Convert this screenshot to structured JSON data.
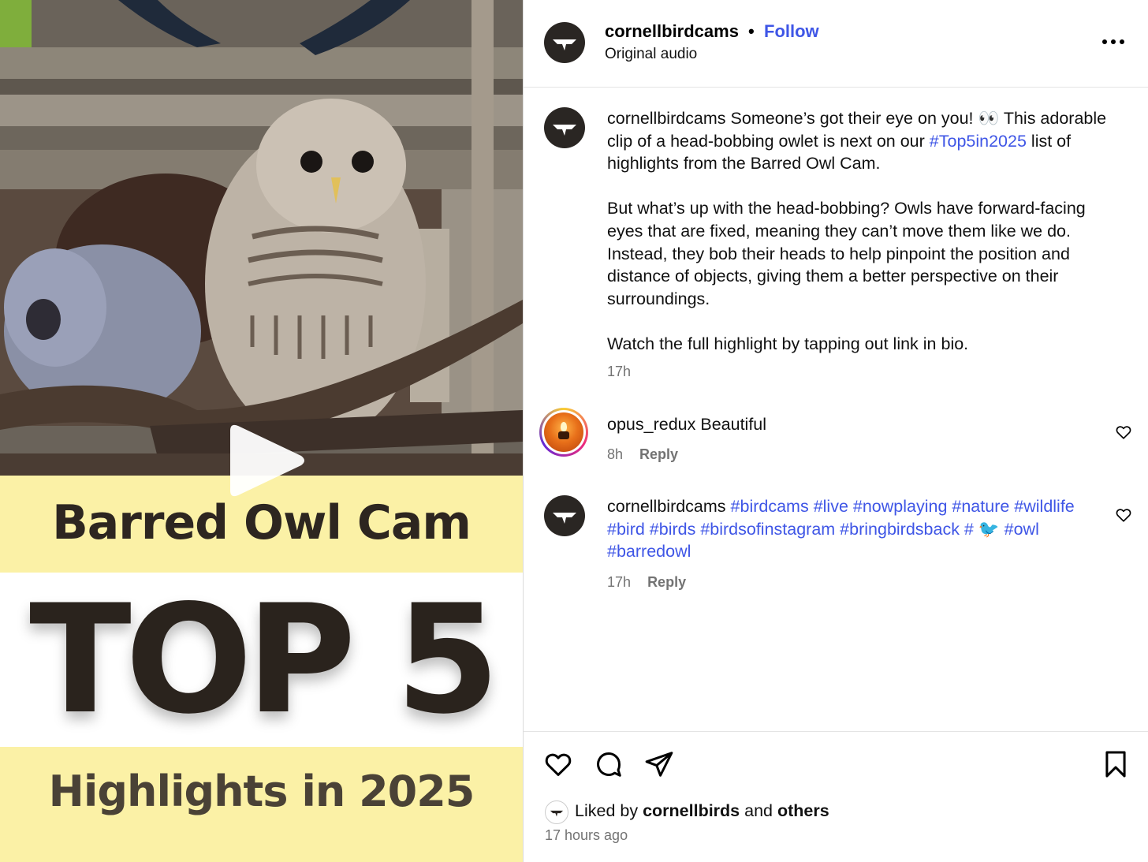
{
  "media": {
    "title": "Barred Owl Cam",
    "headline": "TOP 5",
    "subtitle": "Highlights in 2025"
  },
  "header": {
    "username": "cornellbirdcams",
    "separator": "•",
    "follow_label": "Follow",
    "audio": "Original audio"
  },
  "caption": {
    "username": "cornellbirdcams",
    "text_1": "Someone’s got their eye on you! 👀 This adorable clip of a head-bobbing owlet is next on our",
    "hashtag": "#Top5in2025",
    "text_2": "list of highlights from the Barred Owl Cam.",
    "paragraph_2": "But what’s up with the head-bobbing? Owls have forward-facing eyes that are fixed, meaning they can’t move them like we do. Instead, they bob their heads to help pinpoint the position and distance of objects, giving them a better perspective on their surroundings.",
    "paragraph_3": "Watch the full highlight by tapping out link in bio.",
    "time": "17h"
  },
  "comments": [
    {
      "username": "opus_redux",
      "text": "Beautiful",
      "time": "8h",
      "reply_label": "Reply"
    },
    {
      "username": "cornellbirdcams",
      "hashtags": "#birdcams #live #nowplaying #nature #wildlife #bird #birds #birdsofinstagram #bringbirdsback #",
      "emoji": "🐦",
      "hashtags_2": "#owl #barredowl",
      "time": "17h",
      "reply_label": "Reply"
    }
  ],
  "likes": {
    "prefix": "Liked by",
    "user": "cornellbirds",
    "middle": "and",
    "others": "others",
    "time_ago": "17 hours ago"
  },
  "colors": {
    "link": "#3f56e6",
    "meta": "#737373",
    "band": "#fbf1a6"
  },
  "icons": [
    "play-icon",
    "more-icon",
    "heart-icon",
    "comment-icon",
    "share-icon",
    "bookmark-icon"
  ]
}
